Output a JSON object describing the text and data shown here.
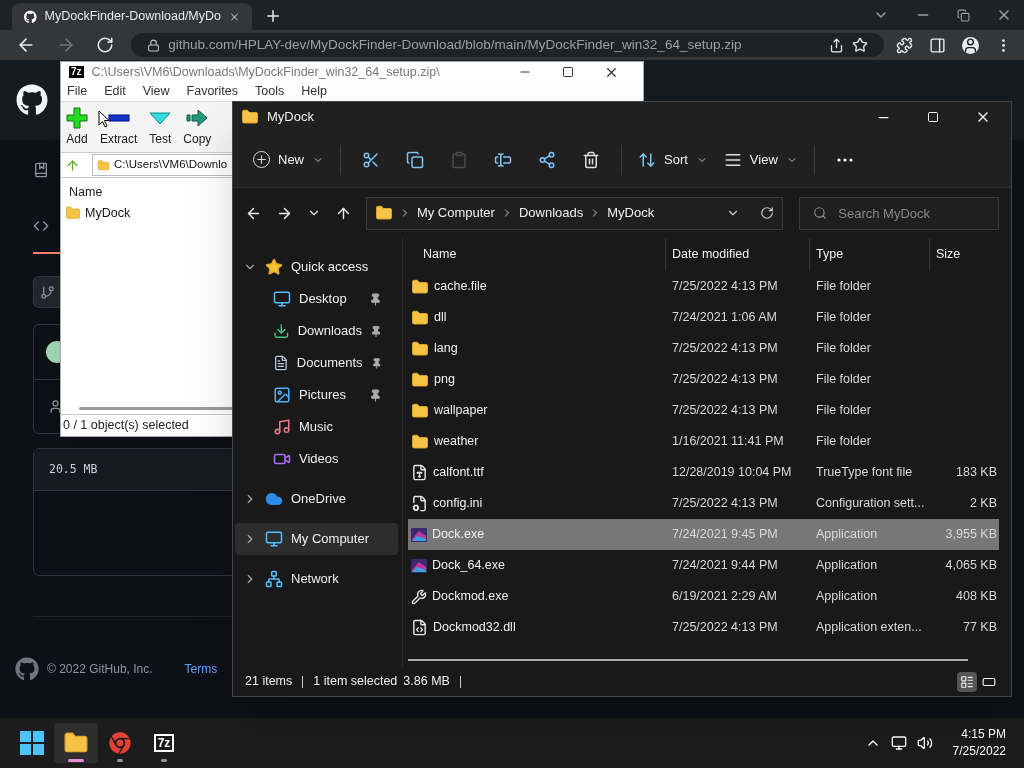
{
  "browser": {
    "tab": {
      "title": "MyDockFinder-Download/MyDo",
      "selected": true
    },
    "nav_buttons": [
      {
        "kind": "back",
        "disabled": false
      },
      {
        "kind": "forward",
        "disabled": true
      },
      {
        "kind": "reload",
        "disabled": false
      }
    ],
    "address": {
      "url": "github.com/HPLAY-dev/MyDockFinder-Download/blob/main/MyDockFinder_win32_64_setup.zip"
    }
  },
  "github": {
    "file_size": "20.5 MB",
    "footer": {
      "copyright": "© 2022 GitHub, Inc.",
      "link": "Terms"
    }
  },
  "sevenzip": {
    "icon_label": "7z",
    "title": "C:\\Users\\VM6\\Downloads\\MyDockFinder_win32_64_setup.zip\\",
    "menu": [
      "File",
      "Edit",
      "View",
      "Favorites",
      "Tools",
      "Help"
    ],
    "toolbar": [
      {
        "kind": "add",
        "label": "Add"
      },
      {
        "kind": "extract",
        "label": "Extract"
      },
      {
        "kind": "test",
        "label": "Test"
      },
      {
        "kind": "copy",
        "label": "Copy"
      }
    ],
    "path": "C:\\Users\\VM6\\Downlo",
    "columns": [
      "Name"
    ],
    "items": [
      {
        "name": "MyDock",
        "selected": false
      }
    ],
    "status": "0 / 1 object(s) selected"
  },
  "explorer": {
    "title": "MyDock",
    "toolbar": [
      {
        "kind": "new",
        "label": "New",
        "disabled": false
      },
      {
        "kind": "cut",
        "disabled": false
      },
      {
        "kind": "copy",
        "disabled": false
      },
      {
        "kind": "paste",
        "disabled": true
      },
      {
        "kind": "rename",
        "disabled": false
      },
      {
        "kind": "share",
        "disabled": false
      },
      {
        "kind": "delete",
        "disabled": false
      },
      {
        "kind": "sort",
        "label": "Sort",
        "disabled": false
      },
      {
        "kind": "view",
        "label": "View",
        "disabled": false
      },
      {
        "kind": "more",
        "disabled": false
      }
    ],
    "breadcrumb": [
      "My Computer",
      "Downloads",
      "MyDock"
    ],
    "search": {
      "placeholder": "Search MyDock"
    },
    "sidebar": [
      {
        "label": "Quick access",
        "kind": "star",
        "expanded": true,
        "selected": false,
        "children": [
          {
            "label": "Desktop",
            "kind": "desktop",
            "pinned": true,
            "selected": false
          },
          {
            "label": "Downloads",
            "kind": "downloads",
            "pinned": true,
            "selected": false
          },
          {
            "label": "Documents",
            "kind": "documents",
            "pinned": true,
            "selected": false
          },
          {
            "label": "Pictures",
            "kind": "pictures",
            "pinned": true,
            "selected": false
          },
          {
            "label": "Music",
            "kind": "music",
            "pinned": false,
            "selected": false
          },
          {
            "label": "Videos",
            "kind": "videos",
            "pinned": false,
            "selected": false
          }
        ]
      },
      {
        "label": "OneDrive",
        "kind": "cloud",
        "expanded": false,
        "selected": false
      },
      {
        "label": "My Computer",
        "kind": "computer",
        "expanded": false,
        "selected": true
      },
      {
        "label": "Network",
        "kind": "network",
        "expanded": false,
        "selected": false
      }
    ],
    "columns": [
      "Name",
      "Date modified",
      "Type",
      "Size"
    ],
    "rows": [
      {
        "name": "cache.file",
        "kind": "folder",
        "date": "7/25/2022 4:13 PM",
        "type": "File folder",
        "size": "",
        "selected": false
      },
      {
        "name": "dll",
        "kind": "folder",
        "date": "7/24/2021 1:06 AM",
        "type": "File folder",
        "size": "",
        "selected": false
      },
      {
        "name": "lang",
        "kind": "folder",
        "date": "7/25/2022 4:13 PM",
        "type": "File folder",
        "size": "",
        "selected": false
      },
      {
        "name": "png",
        "kind": "folder",
        "date": "7/25/2022 4:13 PM",
        "type": "File folder",
        "size": "",
        "selected": false
      },
      {
        "name": "wallpaper",
        "kind": "folder",
        "date": "7/25/2022 4:13 PM",
        "type": "File folder",
        "size": "",
        "selected": false
      },
      {
        "name": "weather",
        "kind": "folder",
        "date": "1/16/2021 11:41 PM",
        "type": "File folder",
        "size": "",
        "selected": false
      },
      {
        "name": "calfont.ttf",
        "kind": "font",
        "date": "12/28/2019 10:04 PM",
        "type": "TrueType font file",
        "size": "183 KB",
        "selected": false
      },
      {
        "name": "config.ini",
        "kind": "config",
        "date": "7/25/2022 4:13 PM",
        "type": "Configuration sett...",
        "size": "2 KB",
        "selected": false
      },
      {
        "name": "Dock.exe",
        "kind": "app",
        "date": "7/24/2021 9:45 PM",
        "type": "Application",
        "size": "3,955 KB",
        "selected": true
      },
      {
        "name": "Dock_64.exe",
        "kind": "app",
        "date": "7/24/2021 9:44 PM",
        "type": "Application",
        "size": "4,065 KB",
        "selected": false
      },
      {
        "name": "Dockmod.exe",
        "kind": "tool",
        "date": "6/19/2021 2:29 AM",
        "type": "Application",
        "size": "408 KB",
        "selected": false
      },
      {
        "name": "Dockmod32.dll",
        "kind": "library",
        "date": "7/25/2022 4:13 PM",
        "type": "Application exten...",
        "size": "77 KB",
        "selected": false
      }
    ],
    "status": {
      "count": "21 items",
      "selection": "1 item selected",
      "size": "3.86 MB"
    },
    "view_modes": [
      {
        "kind": "details",
        "selected": true
      },
      {
        "kind": "tiles",
        "selected": false
      }
    ]
  },
  "taskbar": {
    "apps": [
      {
        "kind": "start",
        "running": false,
        "active": false
      },
      {
        "kind": "explorer",
        "running": true,
        "active": true
      },
      {
        "kind": "chrome",
        "running": true,
        "active": false
      },
      {
        "kind": "sevenzip",
        "label": "7z",
        "running": true,
        "active": false
      }
    ],
    "time": "4:15 PM",
    "date": "7/25/2022"
  }
}
